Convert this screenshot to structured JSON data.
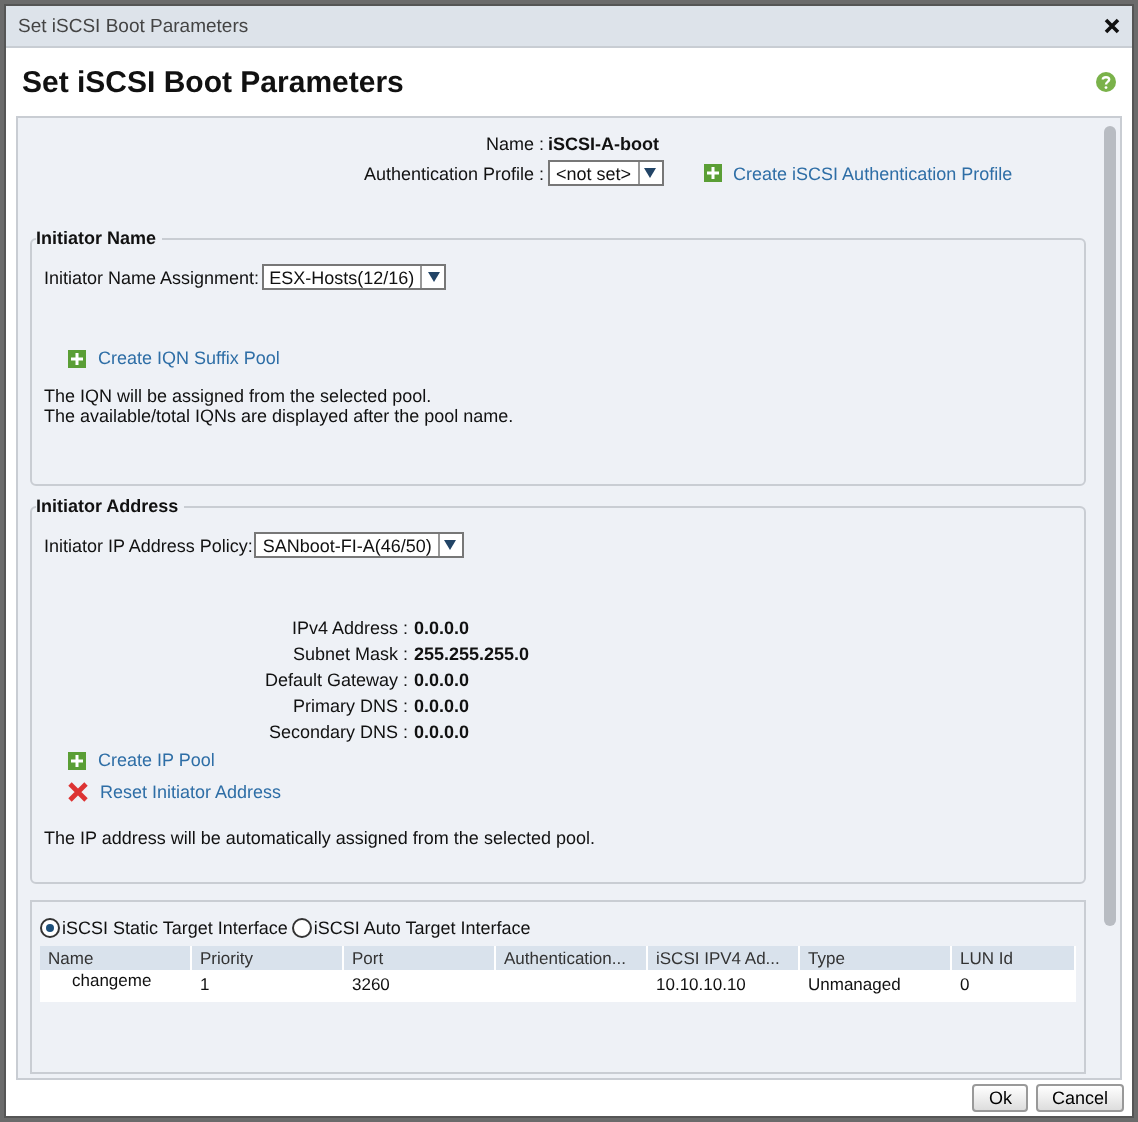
{
  "window": {
    "title": "Set iSCSI Boot Parameters"
  },
  "heading": "Set iSCSI Boot Parameters",
  "name_field": {
    "label": "Name :",
    "value": "iSCSI-A-boot"
  },
  "auth_profile": {
    "label": "Authentication Profile :",
    "value": "<not set>",
    "link": "Create iSCSI Authentication Profile"
  },
  "initiator_name": {
    "title": "Initiator Name",
    "label": "Initiator Name Assignment:",
    "value": "ESX-Hosts(12/16)",
    "link": "Create IQN Suffix Pool",
    "notes": [
      "The IQN will be assigned from the selected pool.",
      "The available/total IQNs are displayed after the pool name."
    ]
  },
  "initiator_address": {
    "title": "Initiator Address",
    "label": "Initiator IP Address Policy:",
    "value": "SANboot-FI-A(46/50)",
    "fields": [
      {
        "label": "IPv4 Address :",
        "value": "0.0.0.0"
      },
      {
        "label": "Subnet Mask :",
        "value": "255.255.255.0"
      },
      {
        "label": "Default Gateway :",
        "value": "0.0.0.0"
      },
      {
        "label": "Primary DNS :",
        "value": "0.0.0.0"
      },
      {
        "label": "Secondary DNS :",
        "value": "0.0.0.0"
      }
    ],
    "links": [
      {
        "kind": "add",
        "label": "Create IP Pool"
      },
      {
        "kind": "reset",
        "label": "Reset Initiator Address"
      }
    ],
    "note": "The IP address will be automatically assigned from the selected pool."
  },
  "target_options": [
    {
      "label": "iSCSI Static Target Interface",
      "selected": true
    },
    {
      "label": "iSCSI Auto Target Interface",
      "selected": false
    }
  ],
  "table": {
    "columns": [
      "Name",
      "Priority",
      "Port",
      "Authentication...",
      "iSCSI IPV4 Ad...",
      "Type",
      "LUN Id"
    ],
    "rows": [
      [
        "changeme",
        "1",
        "3260",
        "",
        "10.10.10.10",
        "Unmanaged",
        "0"
      ]
    ]
  },
  "buttons": [
    "Ok",
    "Cancel"
  ]
}
